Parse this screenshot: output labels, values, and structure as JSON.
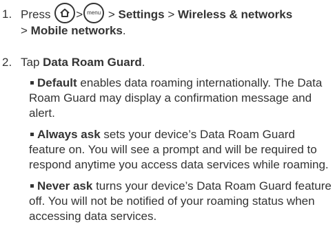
{
  "steps": [
    {
      "number": "1.",
      "text_press": "Press",
      "home_key": "home-icon",
      "menu_key_label": "menu",
      "sep": ">",
      "path_settings": "Settings",
      "path_wireless": "Wireless & networks",
      "path_mobile": "Mobile networks",
      "period": "."
    },
    {
      "number": "2.",
      "text_tap": "Tap",
      "target": "Data Roam Guard",
      "period": "."
    }
  ],
  "options": [
    {
      "term": "Default",
      "description": "enables data roaming internationally. The Data Roam Guard may display a confirmation message and alert."
    },
    {
      "term": "Always ask",
      "description": "sets your device’s Data Roam Guard feature on. You will see a prompt and will be required to respond anytime you access data services while roaming."
    },
    {
      "term": "Never ask",
      "description": "turns your device’s Data Roam Guard feature off. You will not be notified of your roaming status when accessing data services."
    }
  ],
  "colors": {
    "text": "#333333",
    "background": "#ffffff"
  }
}
